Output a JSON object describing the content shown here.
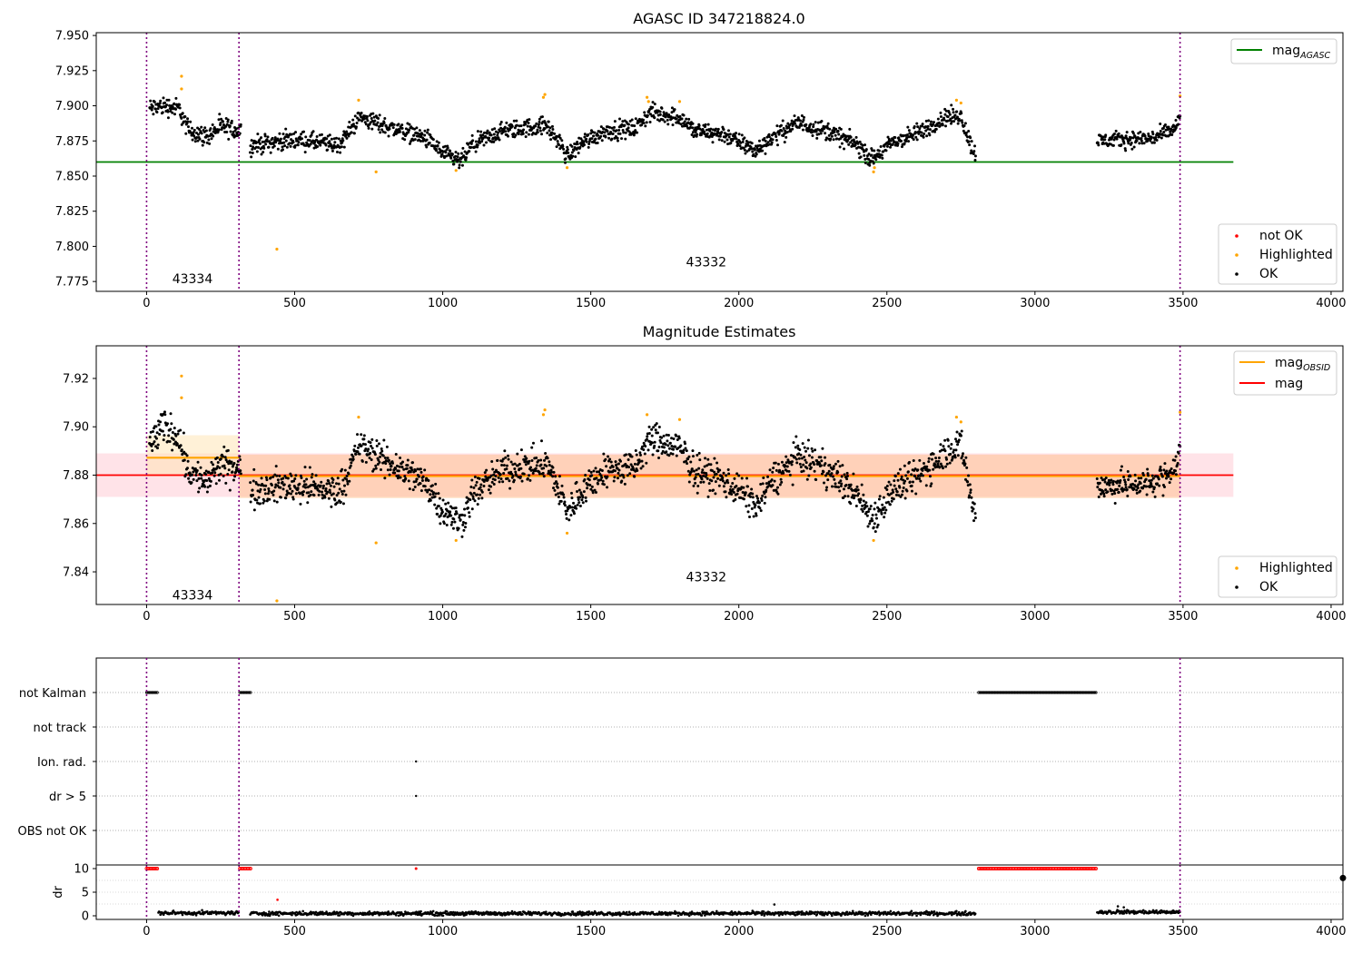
{
  "figure_title": "AGASC ID 347218824.0",
  "chart_data": [
    {
      "type": "scatter",
      "title": "AGASC ID 347218824.0",
      "xlim": [
        -170,
        4040
      ],
      "ylim": [
        7.768,
        7.952
      ],
      "xticks": [
        0,
        500,
        1000,
        1500,
        2000,
        2500,
        3000,
        3500,
        4000
      ],
      "xtick_labels": [
        "0",
        "500",
        "1000",
        "1500",
        "2000",
        "2500",
        "3000",
        "3500",
        "4000"
      ],
      "yticks": [
        7.775,
        7.8,
        7.825,
        7.85,
        7.875,
        7.9,
        7.925,
        7.95
      ],
      "ytick_labels": [
        "7.775",
        "7.800",
        "7.825",
        "7.850",
        "7.875",
        "7.900",
        "7.925",
        "7.950"
      ],
      "obsid_boundaries": [
        0,
        312,
        3490
      ],
      "obsid_labels": [
        {
          "text": "43334",
          "x": 155,
          "y": 7.777
        },
        {
          "text": "43332",
          "x": 1890,
          "y": 7.789
        }
      ],
      "reference_lines": [
        {
          "name": "mag_AGASC",
          "label": "mag",
          "subscript": "AGASC",
          "y": 7.86,
          "x": [
            -170,
            3670
          ],
          "color": "#008000"
        }
      ],
      "legend_lines": [
        {
          "label": "mag",
          "subscript": "AGASC",
          "color": "#008000"
        }
      ],
      "legend_points": [
        {
          "label": "not OK",
          "color": "#ff0000"
        },
        {
          "label": "Highlighted",
          "color": "#ffa500"
        },
        {
          "label": "OK",
          "color": "#000000"
        }
      ],
      "series": [
        {
          "name": "OK",
          "color": "#000000",
          "segments": [
            {
              "x": [
                10,
                320
              ],
              "profile": [
                [
                  10,
                  7.898
                ],
                [
                  60,
                  7.9
                ],
                [
                  110,
                  7.898
                ],
                [
                  140,
                  7.883
                ],
                [
                  200,
                  7.878
                ],
                [
                  250,
                  7.885
                ],
                [
                  320,
                  7.882
                ]
              ],
              "noise": 0.006
            },
            {
              "x": [
                350,
                2800
              ],
              "profile": [
                [
                  350,
                  7.872
                ],
                [
                  500,
                  7.876
                ],
                [
                  650,
                  7.872
                ],
                [
                  720,
                  7.892
                ],
                [
                  800,
                  7.886
                ],
                [
                  900,
                  7.88
                ],
                [
                  950,
                  7.876
                ],
                [
                  1000,
                  7.866
                ],
                [
                  1060,
                  7.86
                ],
                [
                  1100,
                  7.872
                ],
                [
                  1200,
                  7.882
                ],
                [
                  1350,
                  7.886
                ],
                [
                  1400,
                  7.872
                ],
                [
                  1420,
                  7.864
                ],
                [
                  1470,
                  7.874
                ],
                [
                  1550,
                  7.882
                ],
                [
                  1650,
                  7.884
                ],
                [
                  1700,
                  7.895
                ],
                [
                  1800,
                  7.892
                ],
                [
                  1850,
                  7.882
                ],
                [
                  1950,
                  7.88
                ],
                [
                  2000,
                  7.874
                ],
                [
                  2060,
                  7.868
                ],
                [
                  2100,
                  7.876
                ],
                [
                  2200,
                  7.888
                ],
                [
                  2300,
                  7.882
                ],
                [
                  2400,
                  7.872
                ],
                [
                  2450,
                  7.862
                ],
                [
                  2520,
                  7.874
                ],
                [
                  2600,
                  7.88
                ],
                [
                  2700,
                  7.892
                ],
                [
                  2750,
                  7.893
                ],
                [
                  2790,
                  7.868
                ]
              ],
              "noise": 0.0055
            },
            {
              "x": [
                3210,
                3490
              ],
              "profile": [
                [
                  3210,
                  7.875
                ],
                [
                  3300,
                  7.876
                ],
                [
                  3400,
                  7.877
                ],
                [
                  3470,
                  7.883
                ],
                [
                  3490,
                  7.892
                ]
              ],
              "noise": 0.005
            }
          ]
        },
        {
          "name": "Highlighted",
          "color": "#ffa500",
          "points": [
            [
              118,
              7.921
            ],
            [
              118,
              7.912
            ],
            [
              440,
              7.798
            ],
            [
              716,
              7.904
            ],
            [
              775,
              7.853
            ],
            [
              1045,
              7.854
            ],
            [
              1340,
              7.906
            ],
            [
              1345,
              7.908
            ],
            [
              1420,
              7.856
            ],
            [
              1690,
              7.906
            ],
            [
              1695,
              7.903
            ],
            [
              1800,
              7.903
            ],
            [
              2455,
              7.853
            ],
            [
              2458,
              7.856
            ],
            [
              2735,
              7.904
            ],
            [
              2750,
              7.902
            ],
            [
              3490,
              7.907
            ]
          ]
        }
      ]
    },
    {
      "type": "scatter",
      "title": "Magnitude Estimates",
      "xlim": [
        -170,
        4040
      ],
      "ylim": [
        7.8265,
        7.9335
      ],
      "xticks": [
        0,
        500,
        1000,
        1500,
        2000,
        2500,
        3000,
        3500,
        4000
      ],
      "xtick_labels": [
        "0",
        "500",
        "1000",
        "1500",
        "2000",
        "2500",
        "3000",
        "3500",
        "4000"
      ],
      "yticks": [
        7.84,
        7.86,
        7.88,
        7.9,
        7.92
      ],
      "ytick_labels": [
        "7.84",
        "7.86",
        "7.88",
        "7.90",
        "7.92"
      ],
      "obsid_boundaries": [
        0,
        312,
        3490
      ],
      "obsid_labels": [
        {
          "text": "43334",
          "x": 155,
          "y": 7.8305
        },
        {
          "text": "43332",
          "x": 1890,
          "y": 7.838
        }
      ],
      "bands": [
        {
          "x": [
            -170,
            3670
          ],
          "y": [
            7.871,
            7.889
          ],
          "color": "#ffc0cb",
          "opacity": 0.45
        },
        {
          "x": [
            0,
            312
          ],
          "y": [
            7.8795,
            7.8965
          ],
          "color": "#ffe3b0",
          "opacity": 0.5
        },
        {
          "x": [
            312,
            3490
          ],
          "y": [
            7.8705,
            7.8885
          ],
          "color": "#ffb060",
          "opacity": 0.35
        }
      ],
      "reference_lines": [
        {
          "name": "mag",
          "label": "mag",
          "y": 7.88,
          "x": [
            -170,
            3670
          ],
          "color": "#ff0000"
        },
        {
          "name": "mag_OBSID 43334",
          "y": 7.8872,
          "x": [
            0,
            312
          ],
          "color": "#ffa500"
        },
        {
          "name": "mag_OBSID 43332",
          "y": 7.8796,
          "x": [
            312,
            3490
          ],
          "color": "#ffa500"
        }
      ],
      "legend_lines": [
        {
          "label": "mag",
          "subscript": "OBSID",
          "color": "#ffa500"
        },
        {
          "label": "mag",
          "color": "#ff0000"
        }
      ],
      "legend_points": [
        {
          "label": "Highlighted",
          "color": "#ffa500"
        },
        {
          "label": "OK",
          "color": "#000000"
        }
      ],
      "series": [
        {
          "name": "OK",
          "color": "#000000",
          "segments": [
            {
              "x": [
                10,
                320
              ],
              "profile": [
                [
                  10,
                  7.893
                ],
                [
                  60,
                  7.9
                ],
                [
                  110,
                  7.896
                ],
                [
                  140,
                  7.882
                ],
                [
                  200,
                  7.877
                ],
                [
                  250,
                  7.884
                ],
                [
                  320,
                  7.882
                ]
              ],
              "noise": 0.006
            },
            {
              "x": [
                350,
                2800
              ],
              "profile": [
                [
                  350,
                  7.874
                ],
                [
                  500,
                  7.876
                ],
                [
                  650,
                  7.873
                ],
                [
                  720,
                  7.892
                ],
                [
                  800,
                  7.886
                ],
                [
                  900,
                  7.88
                ],
                [
                  950,
                  7.876
                ],
                [
                  1000,
                  7.866
                ],
                [
                  1060,
                  7.86
                ],
                [
                  1100,
                  7.872
                ],
                [
                  1200,
                  7.882
                ],
                [
                  1350,
                  7.885
                ],
                [
                  1400,
                  7.872
                ],
                [
                  1420,
                  7.864
                ],
                [
                  1470,
                  7.874
                ],
                [
                  1550,
                  7.882
                ],
                [
                  1650,
                  7.883
                ],
                [
                  1700,
                  7.895
                ],
                [
                  1800,
                  7.891
                ],
                [
                  1850,
                  7.882
                ],
                [
                  1950,
                  7.878
                ],
                [
                  2000,
                  7.874
                ],
                [
                  2060,
                  7.867
                ],
                [
                  2100,
                  7.876
                ],
                [
                  2200,
                  7.888
                ],
                [
                  2300,
                  7.882
                ],
                [
                  2400,
                  7.872
                ],
                [
                  2450,
                  7.862
                ],
                [
                  2520,
                  7.874
                ],
                [
                  2600,
                  7.879
                ],
                [
                  2700,
                  7.89
                ],
                [
                  2750,
                  7.893
                ],
                [
                  2790,
                  7.867
                ]
              ],
              "noise": 0.006
            },
            {
              "x": [
                3210,
                3490
              ],
              "profile": [
                [
                  3210,
                  7.875
                ],
                [
                  3300,
                  7.876
                ],
                [
                  3400,
                  7.877
                ],
                [
                  3470,
                  7.882
                ],
                [
                  3490,
                  7.89
                ]
              ],
              "noise": 0.005
            }
          ]
        },
        {
          "name": "Highlighted",
          "color": "#ffa500",
          "points": [
            [
              118,
              7.921
            ],
            [
              118,
              7.912
            ],
            [
              440,
              7.828
            ],
            [
              716,
              7.904
            ],
            [
              775,
              7.852
            ],
            [
              1045,
              7.853
            ],
            [
              1340,
              7.905
            ],
            [
              1345,
              7.907
            ],
            [
              1420,
              7.856
            ],
            [
              1690,
              7.905
            ],
            [
              1800,
              7.903
            ],
            [
              2455,
              7.853
            ],
            [
              2735,
              7.904
            ],
            [
              2750,
              7.902
            ],
            [
              3490,
              7.906
            ]
          ]
        }
      ]
    },
    {
      "type": "scatter",
      "title": "",
      "xlim": [
        -170,
        4040
      ],
      "categories": [
        "not Kalman",
        "not track",
        "Ion. rad.",
        "dr > 5",
        "OBS not OK"
      ],
      "xticks": [
        0,
        500,
        1000,
        1500,
        2000,
        2500,
        3000,
        3500,
        4000
      ],
      "xtick_labels": [
        "0",
        "500",
        "1000",
        "1500",
        "2000",
        "2500",
        "3000",
        "3500",
        "4000"
      ],
      "obsid_boundaries": [
        0,
        312,
        3490
      ],
      "series": [
        {
          "name": "not Kalman",
          "color": "#000000",
          "ranges": [
            [
              0,
              40
            ],
            [
              315,
              355
            ],
            [
              2810,
              3210
            ]
          ]
        },
        {
          "name": "Ion. rad.",
          "color": "#000000",
          "points": [
            910
          ]
        },
        {
          "name": "dr > 5",
          "color": "#000000",
          "points": [
            910
          ]
        }
      ]
    },
    {
      "type": "scatter",
      "title": "",
      "ylabel": "dr",
      "xlim": [
        -170,
        4040
      ],
      "ylim": [
        -0.5,
        10.5
      ],
      "yticks": [
        0,
        5,
        10
      ],
      "ytick_labels": [
        "0",
        "5",
        "10"
      ],
      "xticks": [
        0,
        500,
        1000,
        1500,
        2000,
        2500,
        3000,
        3500,
        4000
      ],
      "xtick_labels": [
        "0",
        "500",
        "1000",
        "1500",
        "2000",
        "2500",
        "3000",
        "3500",
        "4000"
      ],
      "obsid_boundaries": [
        0,
        312,
        3490
      ],
      "series": [
        {
          "name": "dr",
          "color": "#000000",
          "segments": [
            {
              "x": [
                40,
                312
              ],
              "level": 0.6
            },
            {
              "x": [
                350,
                2800
              ],
              "level": 0.5
            },
            {
              "x": [
                3210,
                3490
              ],
              "level": 0.8
            }
          ],
          "points": [
            [
              442,
              3.4
            ],
            [
              2120,
              2.4
            ],
            [
              3280,
              2.0
            ],
            [
              3300,
              1.8
            ]
          ]
        },
        {
          "name": "dr capped at 10",
          "color": "#ff0000",
          "ranges": [
            [
              0,
              40
            ],
            [
              315,
              355
            ],
            [
              2810,
              3210
            ]
          ],
          "points": [
            910
          ]
        }
      ]
    }
  ]
}
